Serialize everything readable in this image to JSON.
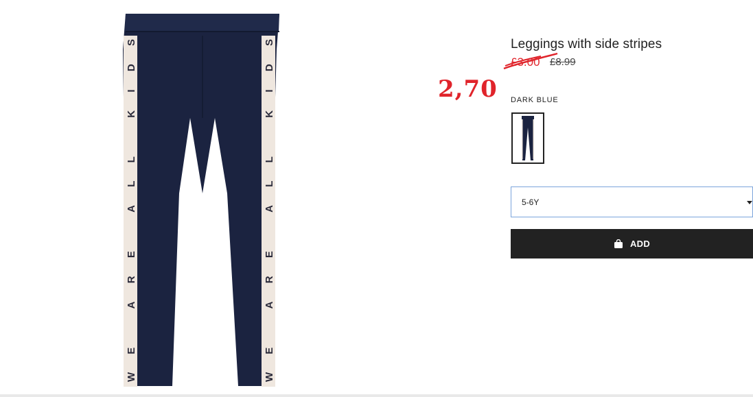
{
  "product": {
    "title": "Leggings with side stripes",
    "sale_price": "£3.00",
    "original_price": "£8.99",
    "handwritten_price": "2,70",
    "color_label": "DARK BLUE",
    "stripe_text": "WE ARE ALL KIDS"
  },
  "size_select": {
    "selected": "5-6Y"
  },
  "add_button": {
    "label": "ADD",
    "icon": "shopping-bag-icon"
  },
  "colors": {
    "accent_red": "#e0242b",
    "button_bg": "#222222",
    "product_navy": "#1b2340",
    "select_border": "#7aa4dc"
  }
}
